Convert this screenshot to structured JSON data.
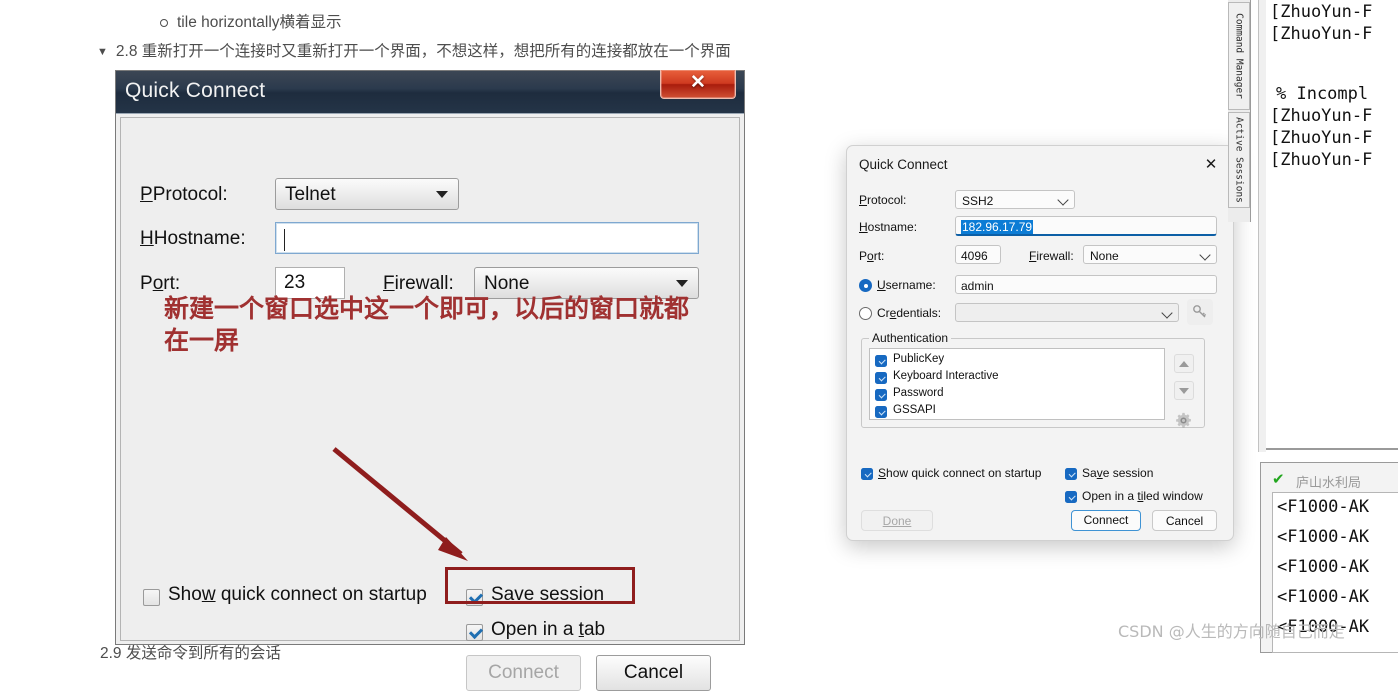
{
  "doc": {
    "sub_bullet": "tile horizontally横着显示",
    "main_bullet": "2.8 重新打开一个连接时又重新打开一个界面，不想这样，想把所有的连接都放在一个界面",
    "tail_bullet": "2.9 发送命令到所有的会话"
  },
  "win7_dialog": {
    "title": "Quick Connect",
    "close_glyph": "✕",
    "protocol_label": "Protocol:",
    "protocol_value": "Telnet",
    "hostname_label": "Hostname:",
    "hostname_value": "",
    "port_label": "Port:",
    "port_value": "23",
    "firewall_label": "Firewall:",
    "firewall_value": "None",
    "show_on_startup_label": "Show quick connect on startup",
    "show_on_startup_checked": false,
    "save_session_label": "Save session",
    "save_session_checked": true,
    "open_in_tab_label": "Open in a tab",
    "open_in_tab_checked": true,
    "connect_label": "Connect",
    "connect_disabled": true,
    "cancel_label": "Cancel",
    "annotation_text": "新建一个窗口选中这一个即可，以后的窗口就都在一屏",
    "annotation_color": "#a03131",
    "highlight_color": "#8f1d1d"
  },
  "win11_dialog": {
    "title": "Quick Connect",
    "close_glyph": "✕",
    "protocol_label": "Protocol:",
    "protocol_value": "SSH2",
    "hostname_label": "Hostname:",
    "hostname_value": "182.96.17.79",
    "port_label": "Port:",
    "port_value": "4096",
    "firewall_label": "Firewall:",
    "firewall_value": "None",
    "username_label": "Username:",
    "username_value": "admin",
    "username_selected": true,
    "credentials_label": "Credentials:",
    "credentials_value": "",
    "credentials_selected": false,
    "key_icon": "key-icon",
    "authentication_label": "Authentication",
    "auth_items": [
      {
        "label": "PublicKey",
        "checked": true
      },
      {
        "label": "Keyboard Interactive",
        "checked": true
      },
      {
        "label": "Password",
        "checked": true
      },
      {
        "label": "GSSAPI",
        "checked": true
      }
    ],
    "move_up_icon": "arrow-up-icon",
    "move_down_icon": "arrow-down-icon",
    "settings_icon": "gear-icon",
    "show_on_startup_label": "Show quick connect on startup",
    "show_on_startup_checked": true,
    "save_session_label": "Save session",
    "save_session_checked": true,
    "open_tiled_label": "Open in a tiled window",
    "open_tiled_checked": true,
    "done_label": "Done",
    "done_disabled": true,
    "connect_label": "Connect",
    "cancel_label": "Cancel",
    "accent_color": "#1769c1"
  },
  "terminal": {
    "vertical_tabs": [
      "Command Manager",
      "Active Sessions"
    ],
    "top_lines": [
      "[ZhuoYun-F",
      "[ZhuoYun-F",
      "",
      " % Incompl",
      "[ZhuoYun-F",
      "[ZhuoYun-F",
      "[ZhuoYun-F"
    ],
    "session_tab": {
      "status_icon": "check-icon",
      "status_color": "#22a61e",
      "label": "庐山水利局"
    },
    "bottom_lines": [
      "<F1000-AK",
      "<F1000-AK",
      "<F1000-AK",
      "<F1000-AK",
      "<F1000-AK"
    ]
  },
  "watermark": "CSDN @人生的方向随自己而走"
}
